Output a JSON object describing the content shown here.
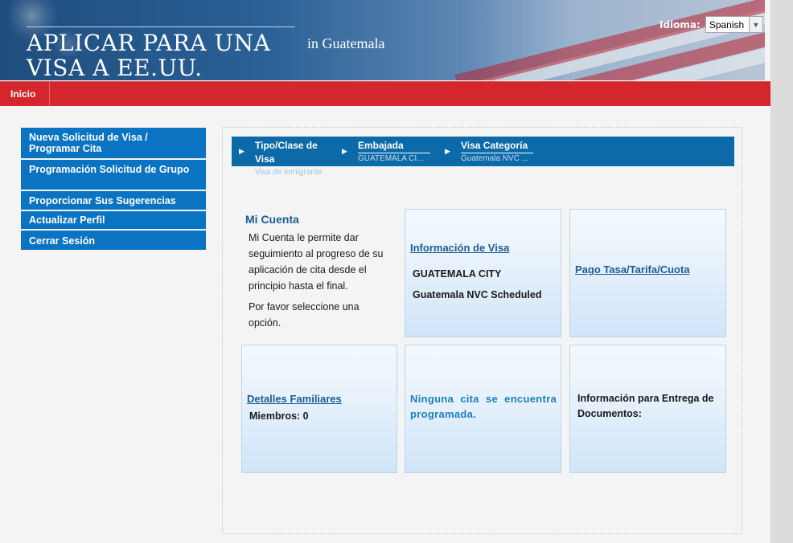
{
  "header": {
    "title_line1": "APLICAR PARA UNA",
    "title_line2": "VISA A EE.UU.",
    "country": "in  Guatemala",
    "language_label": "Idioma:",
    "language_value": "Spanish"
  },
  "nav": {
    "home_label": "Inicio"
  },
  "sidebar": {
    "items": [
      {
        "label": "Nueva Solicitud de Visa / Programar Cita"
      },
      {
        "label": "Programación Solicitud de Grupo"
      },
      {
        "label": "Proporcionar Sus Sugerencias"
      },
      {
        "label": "Actualizar Perfil"
      },
      {
        "label": "Cerrar Sesión"
      }
    ]
  },
  "breadcrumbs": {
    "items": [
      {
        "title": "Tipo/Clase de Visa",
        "sub": "Visa de Inmigrante"
      },
      {
        "title": "Embajada",
        "sub": "GUATEMALA CI..."
      },
      {
        "title": "Visa Categoría",
        "sub": "Guatemala NVC ..."
      }
    ]
  },
  "account": {
    "title": "Mi Cuenta",
    "description": "Mi Cuenta le permite dar seguimiento al progreso de su aplicación de cita desde el principio hasta el final.",
    "instruction": "Por favor seleccione una opción."
  },
  "cards": {
    "visa_info": {
      "link": "Información de Visa",
      "city": "GUATEMALA CITY",
      "category": "Guatemala NVC Scheduled"
    },
    "payment": {
      "link": "Pago Tasa/Tarifa/Cuota"
    },
    "family": {
      "link": "Detalles Familiares",
      "members": "Miembros: 0"
    },
    "appointment": {
      "text": "Ninguna cita se encuentra programada."
    },
    "documents": {
      "text": "Información para Entrega de Documentos:"
    }
  },
  "colors": {
    "nav_red": "#d3262d",
    "sidebar_blue": "#0a73c2",
    "breadcrumb_blue": "#0d6aa8",
    "link_blue": "#1b5c93"
  }
}
